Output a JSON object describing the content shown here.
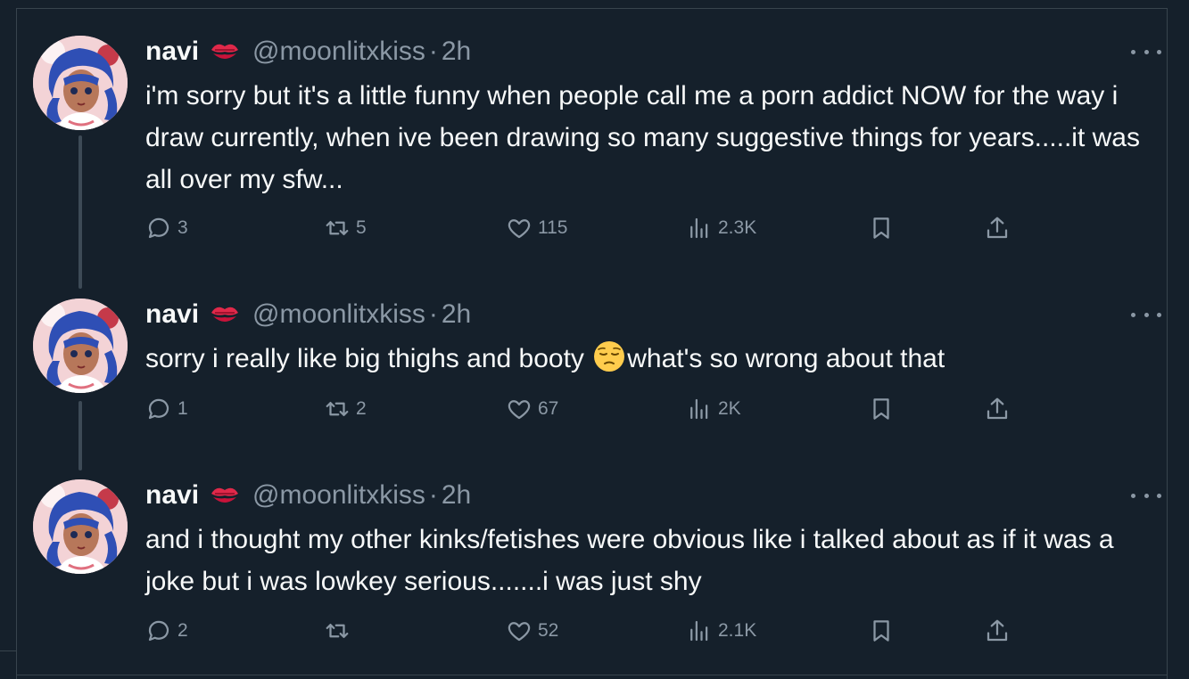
{
  "tweets": [
    {
      "name": "navi",
      "handle": "@moonlitxkiss",
      "separator": "·",
      "time": "2h",
      "text": "i'm sorry but it's a little funny when people call me a porn addict NOW for the way i draw currently, when ive been drawing so many suggestive things for years.....it was all over my sfw...",
      "replies": "3",
      "retweets": "5",
      "likes": "115",
      "views": "2.3K"
    },
    {
      "name": "navi",
      "handle": "@moonlitxkiss",
      "separator": "·",
      "time": "2h",
      "text_before_emoji": "sorry i really like big thighs and booty ",
      "emoji": "pensive-face",
      "text_after_emoji": "what's so wrong about that",
      "replies": "1",
      "retweets": "2",
      "likes": "67",
      "views": "2K"
    },
    {
      "name": "navi",
      "handle": "@moonlitxkiss",
      "separator": "·",
      "time": "2h",
      "text": "and i thought my other kinks/fetishes were obvious like i talked about as if it was a joke but i was lowkey serious.......i was just shy",
      "replies": "2",
      "retweets": "",
      "likes": "52",
      "views": "2.1K"
    }
  ],
  "icons": {
    "name_badge": "kiss-mark-icon",
    "reply": "reply-icon",
    "retweet": "retweet-icon",
    "like": "heart-icon",
    "views": "views-icon",
    "bookmark": "bookmark-icon",
    "share": "share-icon",
    "more": "more-icon"
  },
  "colors": {
    "background": "#15202b",
    "text": "#f7f9f9",
    "secondary": "#8b98a5",
    "border": "#38444d",
    "thread_line": "#3d4a56"
  }
}
